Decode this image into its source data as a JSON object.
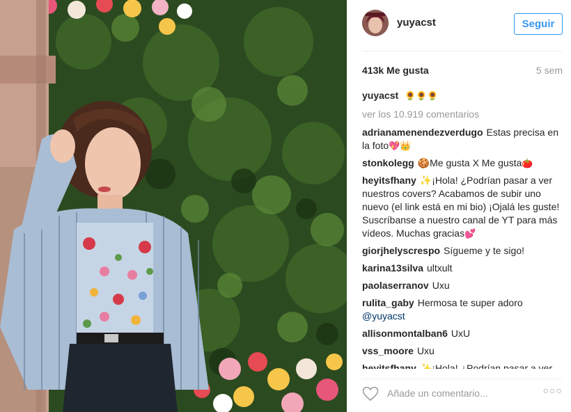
{
  "post": {
    "username": "yuyacst",
    "follow_label": "Seguir",
    "likes": "413k Me gusta",
    "age": "5 sem",
    "caption_emoji": "🌻🌻🌻",
    "view_all": "ver los 10.919 comentarios"
  },
  "comments": [
    {
      "user": "adrianamenendezverdugo",
      "text": "Estas precisa en la foto",
      "emoji": "💖👑"
    },
    {
      "user": "stonkolegg",
      "text": "🍪Me gusta X Me gusta",
      "emoji": "🍅"
    },
    {
      "user": "heyitsfhany",
      "text": "✨¡Hola! ¿Podrían pasar a ver nuestros covers? Acabamos de subir uno nuevo (el link está en mi bio) ¡Ojalá les guste! Suscríbanse a nuestro canal de YT para más vídeos. Muchas gracias",
      "emoji": "💕"
    },
    {
      "user": "giorjhelyscrespo",
      "text": "Sígueme y te sigo!",
      "emoji": ""
    },
    {
      "user": "karina13silva",
      "text": "ultxult",
      "emoji": ""
    },
    {
      "user": "paolaserranov",
      "text": "Uxu",
      "emoji": ""
    },
    {
      "user": "rulita_gaby",
      "text": "Hermosa te super adoro",
      "emoji": "",
      "mention": "@yuyacst"
    },
    {
      "user": "allisonmontalban6",
      "text": "UxU",
      "emoji": ""
    },
    {
      "user": "vss_moore",
      "text": "Uxu",
      "emoji": ""
    },
    {
      "user": "heyitsfhany",
      "text": "✨¡Hola! ¿Podrían pasar a ver",
      "emoji": ""
    }
  ],
  "footer": {
    "comment_placeholder": "Añade un comentario...",
    "more_label": "○○○"
  },
  "icons": {
    "like": "heart-outline-icon",
    "options": "more-options-icon"
  },
  "colors": {
    "accent": "#3897f0",
    "text": "#262626",
    "muted": "#999999",
    "mention": "#003569"
  }
}
